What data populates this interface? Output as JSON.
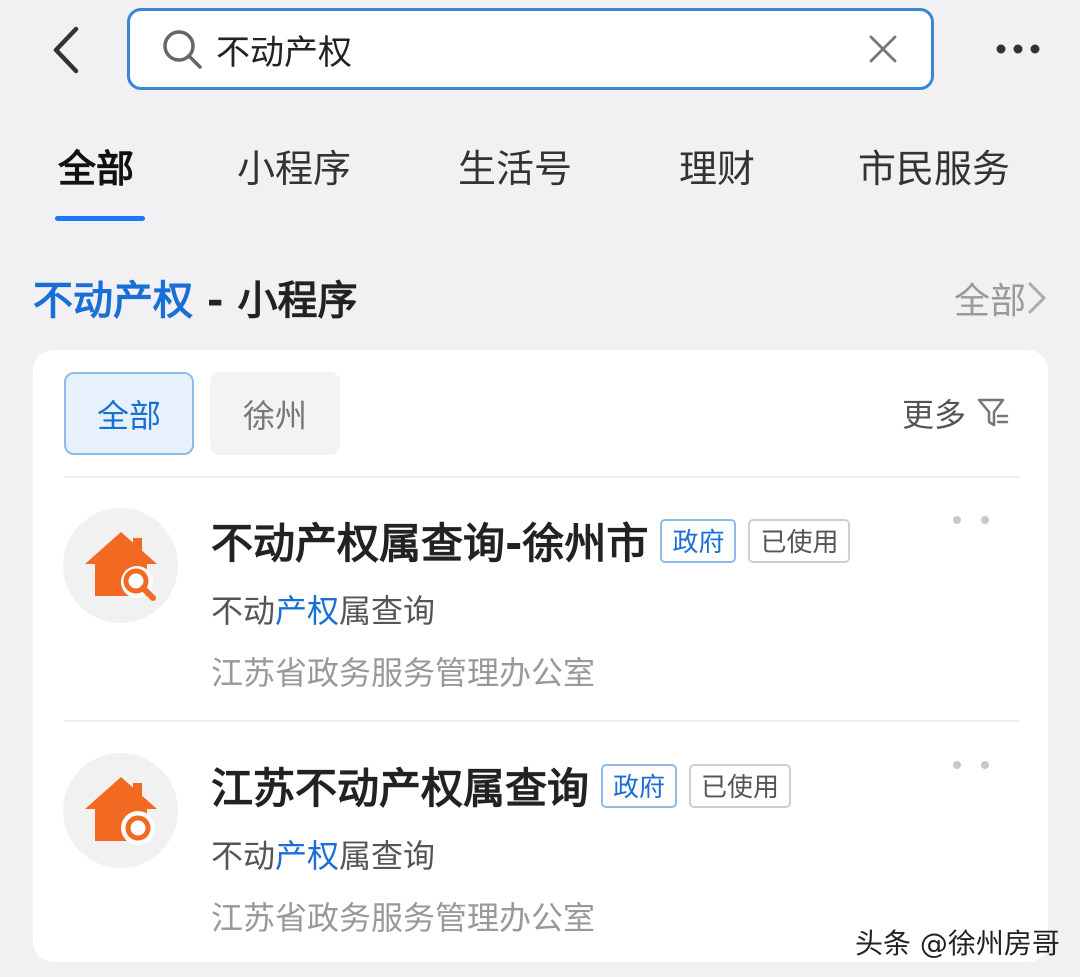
{
  "search": {
    "query": "不动产权"
  },
  "tabs": [
    {
      "label": "全部",
      "active": true
    },
    {
      "label": "小程序",
      "active": false
    },
    {
      "label": "生活号",
      "active": false
    },
    {
      "label": "理财",
      "active": false
    },
    {
      "label": "市民服务",
      "active": false
    }
  ],
  "section": {
    "keyword": "不动产权",
    "suffix": " - 小程序",
    "all_label": "全部"
  },
  "filters": {
    "chips": [
      {
        "label": "全部",
        "selected": true
      },
      {
        "label": "徐州",
        "selected": false
      }
    ],
    "more_label": "更多"
  },
  "results": [
    {
      "title": "不动产权属查询-徐州市",
      "tags": [
        "政府",
        "已使用"
      ],
      "sub_prefix": "不动",
      "sub_highlight": "产权",
      "sub_suffix": "属查询",
      "org": "江苏省政务服务管理办公室",
      "icon": "house-search-icon"
    },
    {
      "title": "江苏不动产权属查询",
      "tags": [
        "政府",
        "已使用"
      ],
      "sub_prefix": "不动",
      "sub_highlight": "产权",
      "sub_suffix": "属查询",
      "org": "江苏省政务服务管理办公室",
      "icon": "house-ring-icon"
    }
  ],
  "watermark": "头条 @徐州房哥",
  "colors": {
    "accent": "#1a6fd6",
    "search_border": "#3a86d6",
    "icon_orange": "#f26a21",
    "background": "#f1f1f3"
  }
}
